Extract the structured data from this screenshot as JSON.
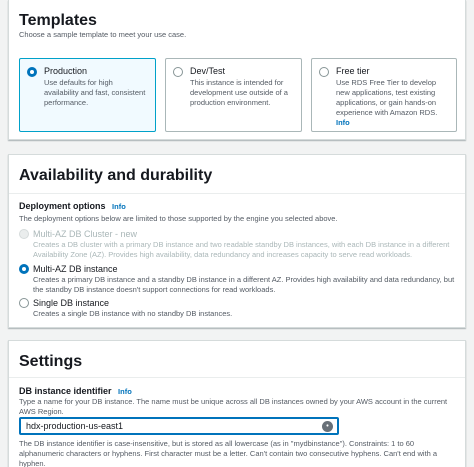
{
  "templates": {
    "title": "Templates",
    "description": "Choose a sample template to meet your use case.",
    "options": [
      {
        "label": "Production",
        "description": "Use defaults for high availability and fast, consistent performance.",
        "selected": true
      },
      {
        "label": "Dev/Test",
        "description": "This instance is intended for development use outside of a production environment.",
        "selected": false
      },
      {
        "label": "Free tier",
        "description": "Use RDS Free Tier to develop new applications, test existing applications, or gain hands-on experience with Amazon RDS.",
        "info": "Info",
        "selected": false
      }
    ]
  },
  "availability": {
    "title": "Availability and durability",
    "deployment_label": "Deployment options",
    "info": "Info",
    "deployment_desc": "The deployment options below are limited to those supported by the engine you selected above.",
    "options": [
      {
        "label": "Multi-AZ DB Cluster - new",
        "description": "Creates a DB cluster with a primary DB instance and two readable standby DB instances, with each DB instance in a different Availability Zone (AZ). Provides high availability, data redundancy and increases capacity to serve read workloads.",
        "selected": false,
        "disabled": true
      },
      {
        "label": "Multi-AZ DB instance",
        "description": "Creates a primary DB instance and a standby DB instance in a different AZ. Provides high availability and data redundancy, but the standby DB instance doesn't support connections for read workloads.",
        "selected": true,
        "disabled": false
      },
      {
        "label": "Single DB instance",
        "description": "Creates a single DB instance with no standby DB instances.",
        "selected": false,
        "disabled": false
      }
    ]
  },
  "settings": {
    "title": "Settings",
    "identifier_label": "DB instance identifier",
    "info": "Info",
    "identifier_desc": "Type a name for your DB instance. The name must be unique across all DB instances owned by your AWS account in the current AWS Region.",
    "identifier_value": "hdx-production-us-east1",
    "constraint": "The DB instance identifier is case-insensitive, but is stored as all lowercase (as in \"mydbinstance\"). Constraints: 1 to 60 alphanumeric characters or hyphens. First character must be a letter. Can't contain two consecutive hyphens. Can't end with a hyphen."
  }
}
